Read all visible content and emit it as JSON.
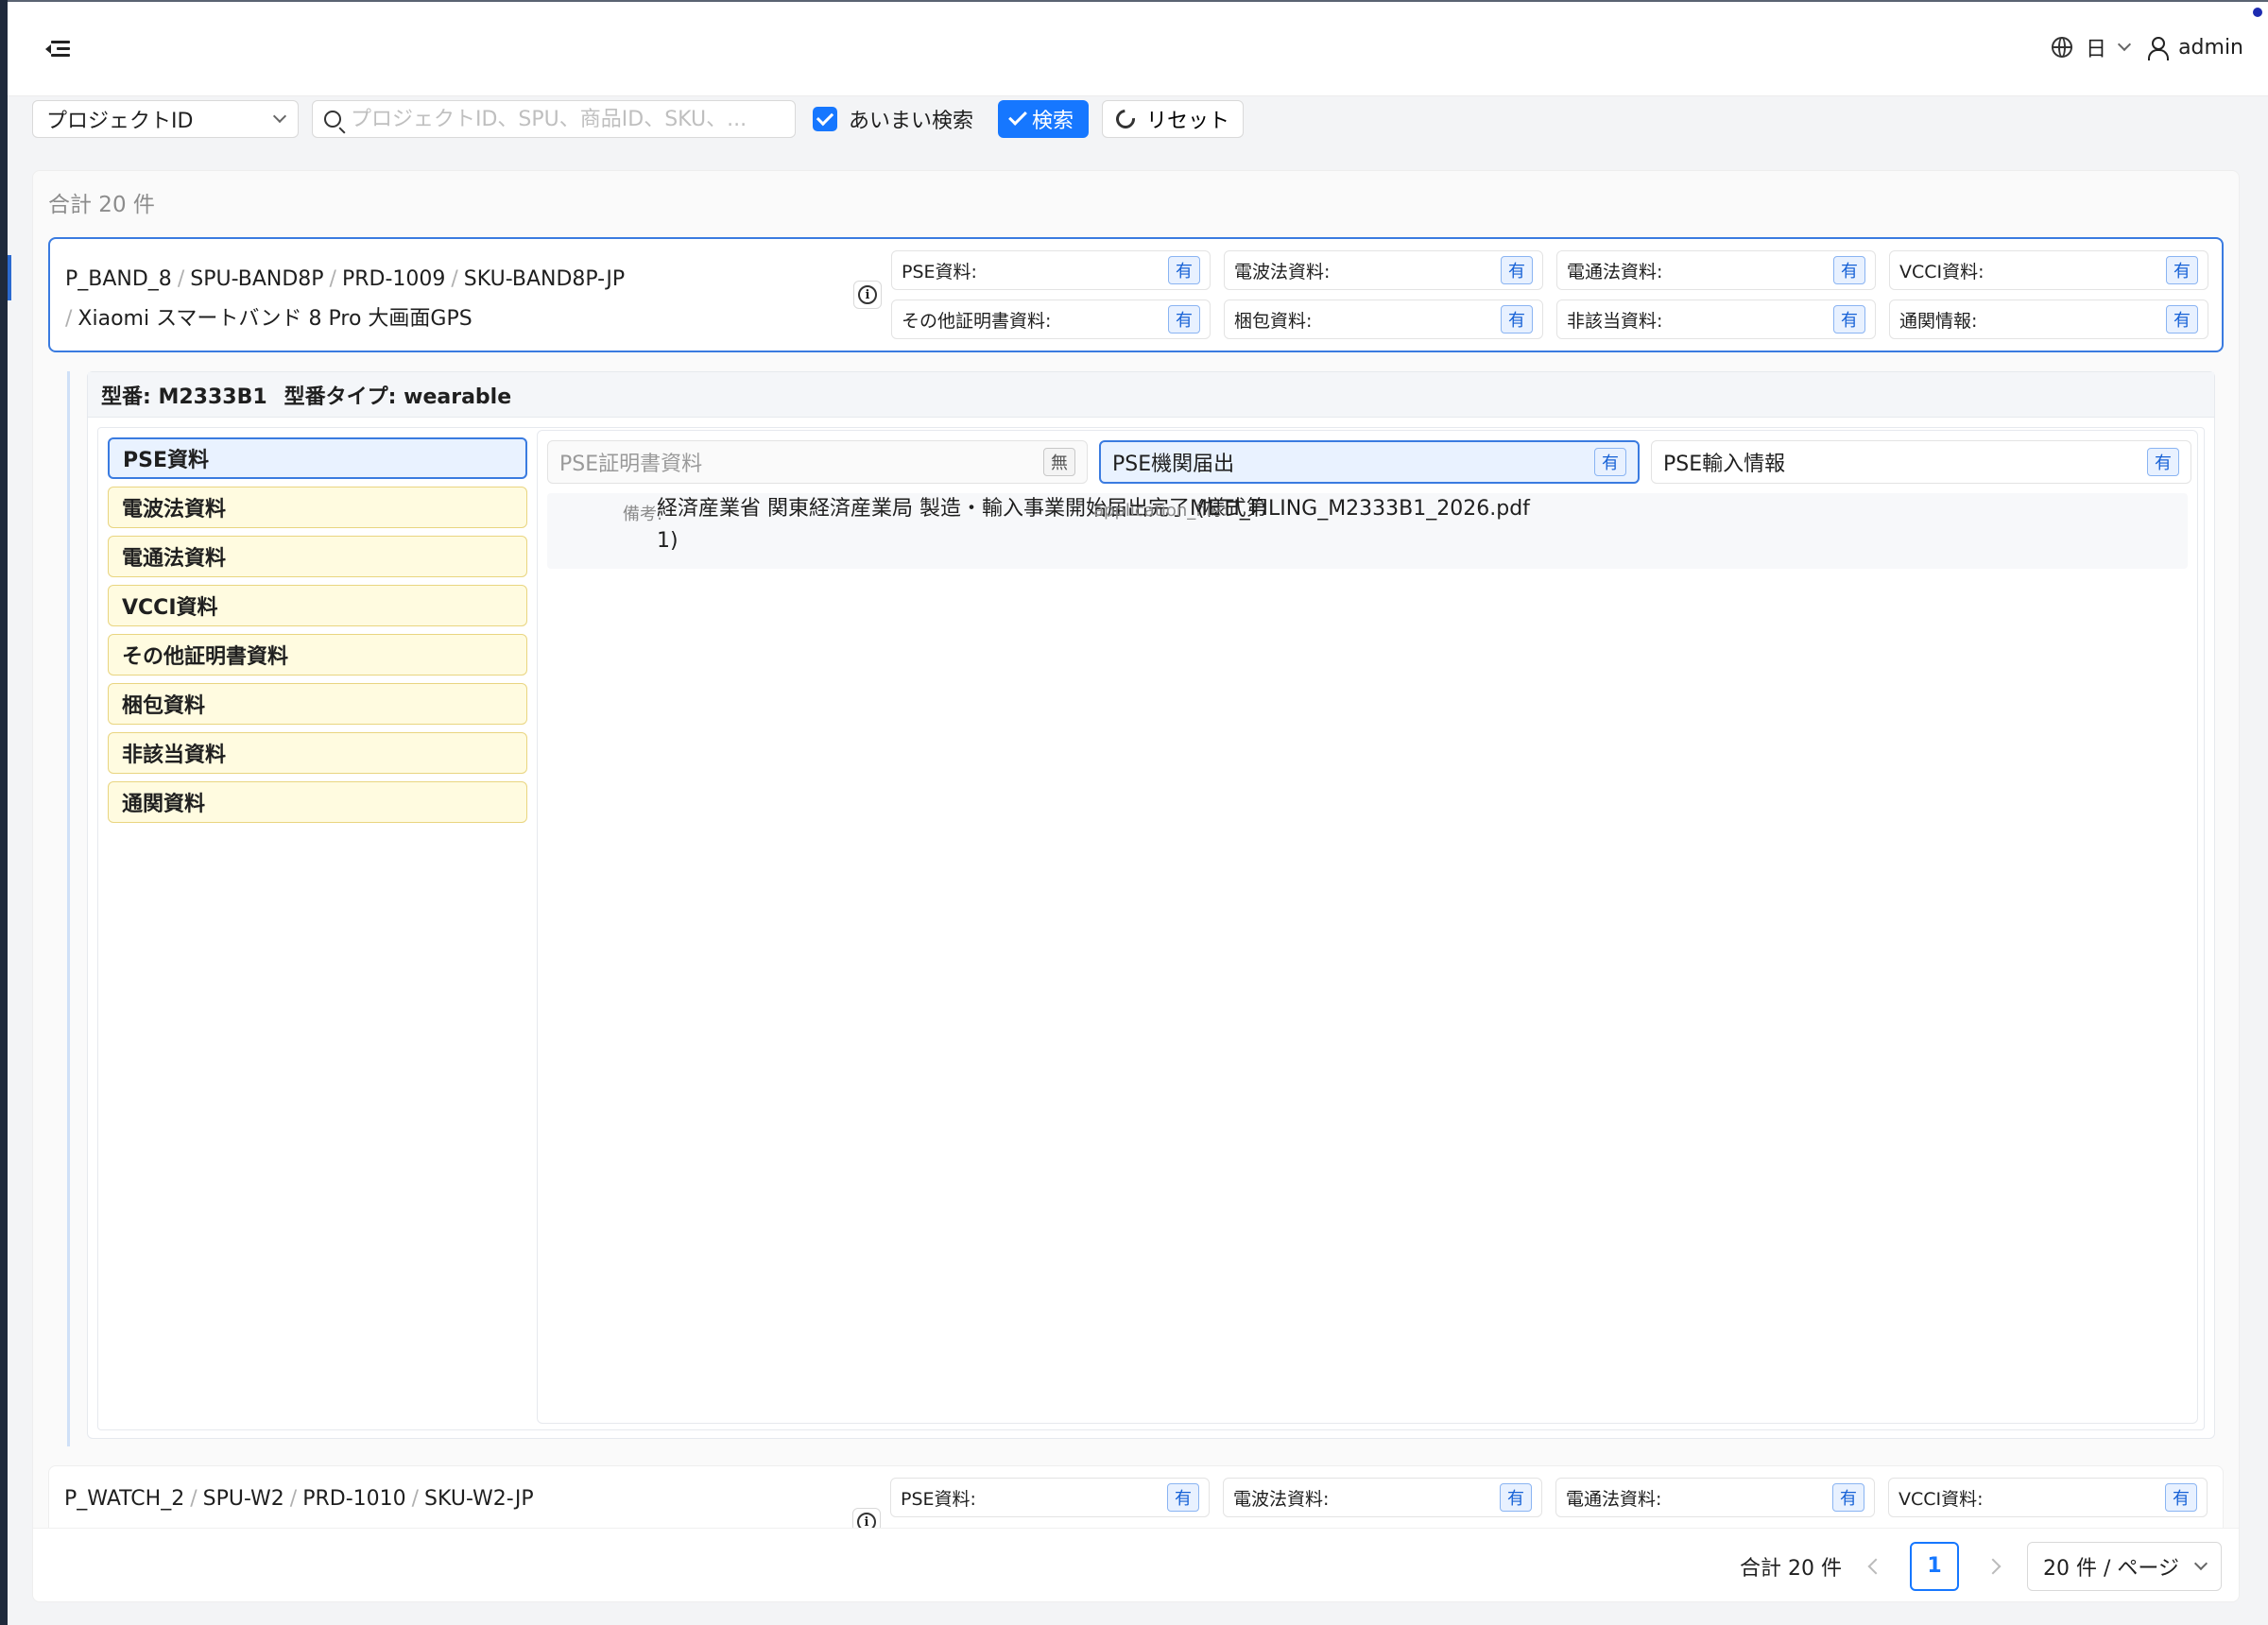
{
  "header": {
    "language": "日",
    "user": "admin"
  },
  "search": {
    "field_select": "プロジェクトID",
    "placeholder": "プロジェクトID、SPU、商品ID、SKU、...",
    "fuzzy_label": "あいまい検索",
    "search_button": "検索",
    "reset_button": "リセット"
  },
  "list": {
    "total_top": "合計 20 件"
  },
  "card1": {
    "project": "P_BAND_8",
    "spu": "SPU-BAND8P",
    "product": "PRD-1009",
    "sku": "SKU-BAND8P-JP",
    "name": "Xiaomi スマートバンド 8 Pro 大画面GPS",
    "info_glyph": "i",
    "flags": [
      {
        "label": "PSE資料:",
        "value": "有"
      },
      {
        "label": "電波法資料:",
        "value": "有"
      },
      {
        "label": "電通法資料:",
        "value": "有"
      },
      {
        "label": "VCCI資料:",
        "value": "有"
      },
      {
        "label": "その他証明書資料:",
        "value": "有"
      },
      {
        "label": "梱包資料:",
        "value": "有"
      },
      {
        "label": "非該当資料:",
        "value": "有"
      },
      {
        "label": "通関情報:",
        "value": "有"
      }
    ]
  },
  "model": {
    "model_label": "型番: M2333B1",
    "type_label": "型番タイプ: wearable",
    "tabs": [
      "PSE資料",
      "電波法資料",
      "電通法資料",
      "VCCI資料",
      "その他証明書資料",
      "梱包資料",
      "非該当資料",
      "通関資料"
    ],
    "subtabs": [
      {
        "label": "PSE証明書資料",
        "value": "無"
      },
      {
        "label": "PSE機関届出",
        "value": "有"
      },
      {
        "label": "PSE輸入情報",
        "value": "有"
      }
    ],
    "detail": {
      "note_label": "備考:",
      "note_line1": "経済産業省 関東経済産業局 製造・輸入事業開始届出完了 (様式第",
      "note_line2": "1)",
      "file_label": "application_file:",
      "file_value": "METI_FILING_M2333B1_2026.pdf"
    }
  },
  "card2": {
    "project": "P_WATCH_2",
    "spu": "SPU-W2",
    "product": "PRD-1010",
    "sku": "SKU-W2-JP",
    "flags": [
      {
        "label": "PSE資料:",
        "value": "有"
      },
      {
        "label": "電波法資料:",
        "value": "有"
      },
      {
        "label": "電通法資料:",
        "value": "有"
      },
      {
        "label": "VCCI資料:",
        "value": "有"
      }
    ]
  },
  "pagination": {
    "total": "合計 20 件",
    "current": "1",
    "page_size": "20 件 / ページ"
  }
}
